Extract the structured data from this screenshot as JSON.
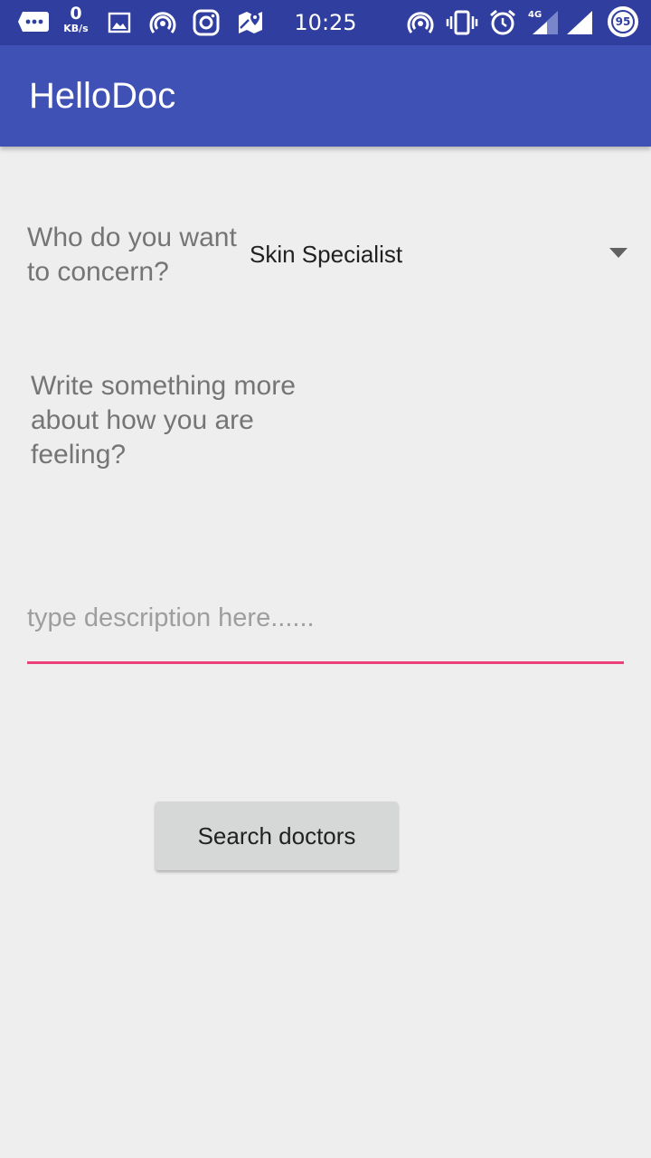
{
  "status_bar": {
    "net_speed_value": "0",
    "net_speed_unit": "KB/s",
    "time": "10:25",
    "network_type": "4G",
    "battery_level": "95",
    "icons_left": [
      "message-icon",
      "image-icon",
      "hotspot-icon",
      "instagram-icon",
      "maps-icon"
    ],
    "icons_right": [
      "hotspot-icon",
      "vibrate-icon",
      "alarm-icon",
      "signal-4g-icon",
      "signal-icon",
      "battery-icon"
    ]
  },
  "app_bar": {
    "title": "HelloDoc",
    "color": "#3f51b5"
  },
  "form": {
    "concern_label": "Who do you want to concern?",
    "concern_selected": "Skin Specialist",
    "feeling_label": "Write something more about how you are feeling?",
    "description_value": "",
    "description_placeholder": "type description here......",
    "underline_color": "#ec407a"
  },
  "actions": {
    "search_label": "Search doctors"
  }
}
